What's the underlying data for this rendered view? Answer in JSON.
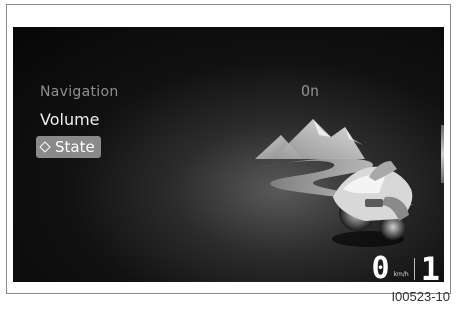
{
  "menu": {
    "items": [
      {
        "label": "Navigation"
      },
      {
        "label": "Volume"
      },
      {
        "label": "State"
      }
    ],
    "selected_value": "On"
  },
  "status": {
    "speed": "0",
    "speed_unit": "km/h",
    "gear": "1"
  },
  "figure_id": "I00523-10"
}
